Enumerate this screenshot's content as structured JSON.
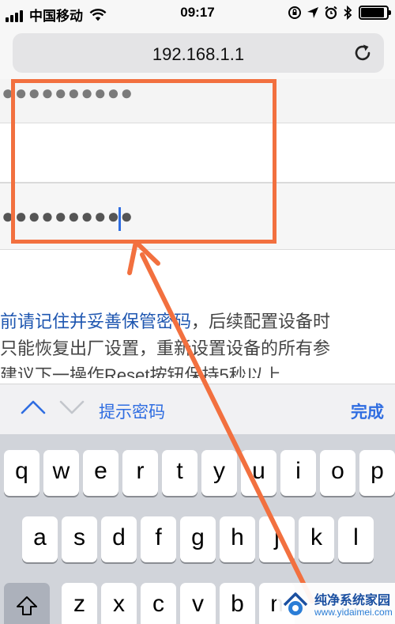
{
  "status_bar": {
    "carrier": "中国移动",
    "time": "09:17",
    "battery_level": 0.9
  },
  "browser": {
    "url": "192.168.1.1"
  },
  "form": {
    "password_dots_1": "●●●●●●●●●●",
    "password_dots_2": "●●●●●●●●●●"
  },
  "notice": {
    "line1_highlight": "前请记住并妥善保管密码",
    "line1_rest": "，后续配置设备时",
    "line2": "只能恢复出厂设置，重新设置设备的所有参",
    "line3": "建议下一操作Reset按钮保持5秒以上"
  },
  "accessory_bar": {
    "suggest_password": "提示密码",
    "done": "完成"
  },
  "keyboard": {
    "row1": [
      "q",
      "w",
      "e",
      "r",
      "t",
      "y",
      "u",
      "i",
      "o",
      "p"
    ],
    "row2": [
      "a",
      "s",
      "d",
      "f",
      "g",
      "h",
      "j",
      "k",
      "l"
    ],
    "row3": [
      "z",
      "x",
      "c",
      "v",
      "b",
      "n"
    ]
  },
  "watermark": {
    "title": "纯净系统家园",
    "url": "www.yidaimei.com"
  },
  "colors": {
    "annotation": "#f2703f",
    "link_blue": "#2f6de1"
  }
}
